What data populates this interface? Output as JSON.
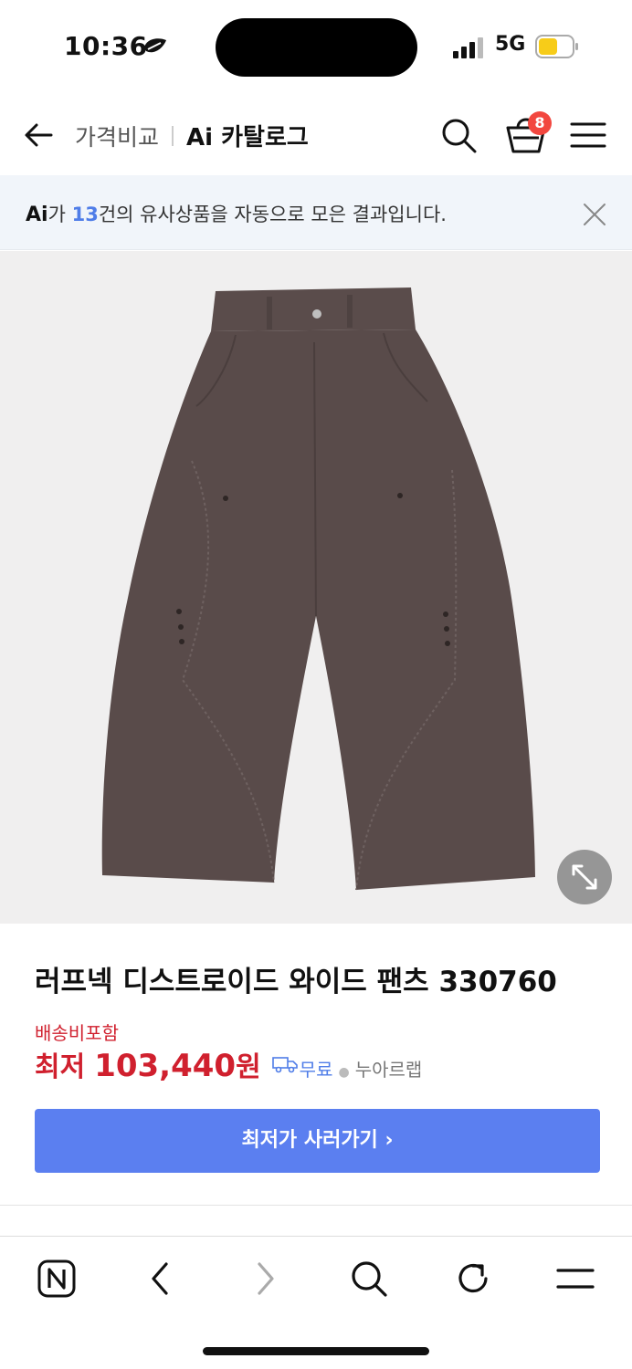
{
  "status_bar": {
    "time": "10:36",
    "network": "5G",
    "battery_color": "#f7cc19"
  },
  "header": {
    "back_icon": "arrow-left-icon",
    "breadcrumb_parent": "가격비교",
    "breadcrumb_current": "Ai 카탈로그",
    "cart_count": "8",
    "cart_badge_color": "#f2473f"
  },
  "ai_banner": {
    "logo": "Ai",
    "text_before_count": "가 ",
    "count": "13",
    "text_after_count": "건의 유사상품을 자동으로 모은 결과입니다.",
    "accent_color": "#4f7de8"
  },
  "product": {
    "image_alt": "brown wide pants",
    "title": "러프넥 디스트로이드 와이드 팬츠 330760",
    "shipping_note": "배송비포함",
    "price_prefix": "최저",
    "price_value": "103,440",
    "price_unit": "원",
    "free_shipping": "무료",
    "seller": "누아르랩",
    "price_color": "#d0202e"
  },
  "cta": {
    "label": "최저가 사러가기 ›",
    "color": "#5b7ff0"
  },
  "toolbar": {
    "items": [
      "naver-home-icon",
      "back-icon",
      "forward-icon",
      "search-icon",
      "refresh-icon",
      "menu-icon"
    ]
  }
}
